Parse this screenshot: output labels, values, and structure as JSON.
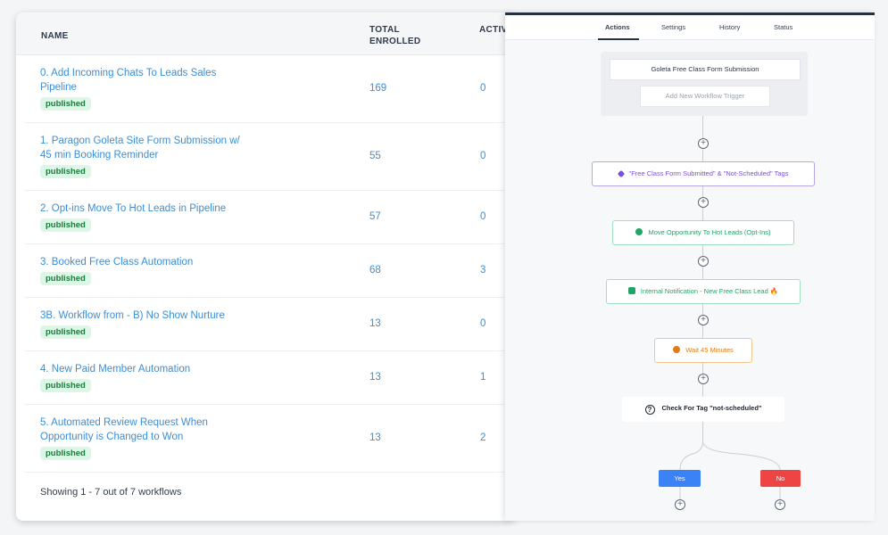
{
  "table": {
    "headers": {
      "name": "NAME",
      "total_enrolled": "TOTAL ENROLLED",
      "active_enrolled": "ACTIVE ENROLLED"
    },
    "rows": [
      {
        "name": "0. Add Incoming Chats To Leads Sales Pipeline",
        "status": "published",
        "total": "169",
        "active": "0"
      },
      {
        "name": "1. Paragon Goleta Site Form Submission w/ 45 min Booking Reminder",
        "status": "published",
        "total": "55",
        "active": "0"
      },
      {
        "name": "2. Opt-ins Move To Hot Leads in Pipeline",
        "status": "published",
        "total": "57",
        "active": "0"
      },
      {
        "name": "3. Booked Free Class Automation",
        "status": "published",
        "total": "68",
        "active": "3"
      },
      {
        "name": "3B. Workflow from - B) No Show Nurture",
        "status": "published",
        "total": "13",
        "active": "0"
      },
      {
        "name": "4. New Paid Member Automation",
        "status": "published",
        "total": "13",
        "active": "1"
      },
      {
        "name": "5. Automated Review Request When Opportunity is Changed to Won",
        "status": "published",
        "total": "13",
        "active": "2"
      }
    ],
    "footer": "Showing 1 - 7 out of 7 workflows"
  },
  "builder": {
    "tabs": [
      "Actions",
      "Settings",
      "History",
      "Status"
    ],
    "active_tab": "Actions",
    "trigger": "Goleta Free Class Form Submission",
    "add_trigger": "Add New Workflow Trigger",
    "steps": {
      "tags": "\"Free Class Form Submitted\" & \"Not-Scheduled\" Tags",
      "move": "Move Opportunity To Hot Leads (Opt-Ins)",
      "notify": "Internal Notification - New Free Class Lead 🔥",
      "wait": "Wait 45 Minutes",
      "check": "Check For Tag \"not-scheduled\""
    },
    "branches": {
      "yes": "Yes",
      "no": "No"
    },
    "colors": {
      "tags": "#7a4fd8",
      "move": "#1fa565",
      "notify": "#1fa565",
      "wait": "#e27a12",
      "yes": "#3b82f6",
      "no": "#ef4444"
    }
  }
}
